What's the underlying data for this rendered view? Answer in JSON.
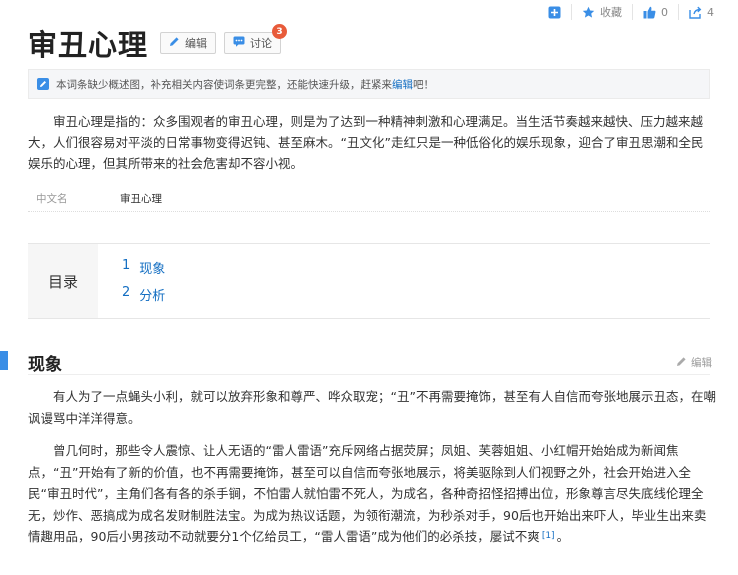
{
  "top_actions": {
    "add_icon": "plus-square-icon",
    "favorite_icon": "star-icon",
    "favorite_label": "收藏",
    "like_icon": "thumbs-up-icon",
    "like_count": "0",
    "share_icon": "share-icon",
    "share_count": "4",
    "accent": "#3a8ee6"
  },
  "header": {
    "title": "审丑心理",
    "edit_label": "编辑",
    "discuss_label": "讨论",
    "discuss_badge": "3",
    "badge_color": "#e85b3a"
  },
  "notice": {
    "prefix": "本词条缺少",
    "bold": "概述图",
    "middle": "，补充相关内容使词条更完整，还能快速升级，赶紧来",
    "link": "编辑",
    "suffix": "吧！"
  },
  "summary": "审丑心理是指的：众多围观者的审丑心理，则是为了达到一种精神刺激和心理满足。当生活节奏越来越快、压力越来越大，人们很容易对平淡的日常事物变得迟钝、甚至麻木。“丑文化”走红只是一种低俗化的娱乐现象，迎合了审丑思潮和全民娱乐的心理，但其所带来的社会危害却不容小视。",
  "basic_info": {
    "key": "中文名",
    "value": "审丑心理"
  },
  "catalog": {
    "title": "目录",
    "items": [
      {
        "num": "1",
        "label": "现象"
      },
      {
        "num": "2",
        "label": "分析"
      }
    ]
  },
  "section": {
    "title": "现象",
    "edit_label": "编辑"
  },
  "paragraphs": {
    "p1": "有人为了一点蝇头小利，就可以放弃形象和尊严、哗众取宠；“丑”不再需要掩饰，甚至有人自信而夸张地展示丑态，在嘲讽谩骂中洋洋得意。",
    "p2": "曾几何时，那些令人震惊、让人无语的“雷人雷语”充斥网络占据荧屏；凤姐、芙蓉姐姐、小红帽开始始成为新闻焦点，“丑”开始有了新的价值，也不再需要掩饰，甚至可以自信而夸张地展示，将美驱除到人们视野之外，社会开始进入全民“审丑时代”，主角们各有各的杀手锏，不怕雷人就怕雷不死人，为成名，各种奇招怪招搏出位，形象尊言尽失底线伦理全无，炒作、恶搞成为成名发财制胜法宝。为成为热议话题，为领衔潮流，为秒杀对手，90后也开始出来吓人，毕业生出来卖情趣用品，90后小男孩动不动就要分1个亿给员工，“雷人雷语”成为他们的必杀技，屡试不爽",
    "p2_ref": "[1]",
    "p2_end": "。"
  }
}
